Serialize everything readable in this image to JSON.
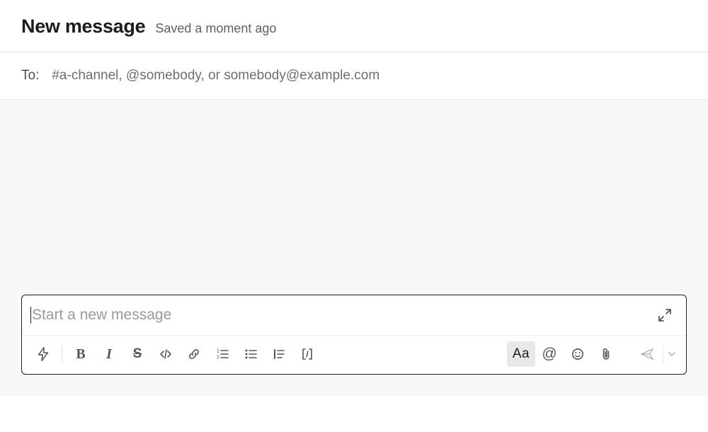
{
  "header": {
    "title": "New message",
    "saved_status": "Saved a moment ago"
  },
  "to": {
    "label": "To:",
    "value": "",
    "placeholder": "#a-channel, @somebody, or somebody@example.com"
  },
  "composer": {
    "value": "",
    "placeholder": "Start a new message"
  },
  "toolbar": {
    "shortcuts": "shortcuts",
    "bold": "B",
    "italic": "I",
    "strike": "S",
    "code": "code",
    "link": "link",
    "ordered_list": "ordered-list",
    "bullet_list": "bullet-list",
    "blockquote": "blockquote",
    "code_block": "code-block",
    "format": "Aa",
    "mention": "@",
    "emoji": "emoji",
    "attach": "attach",
    "send": "send",
    "send_options": "send-options"
  }
}
